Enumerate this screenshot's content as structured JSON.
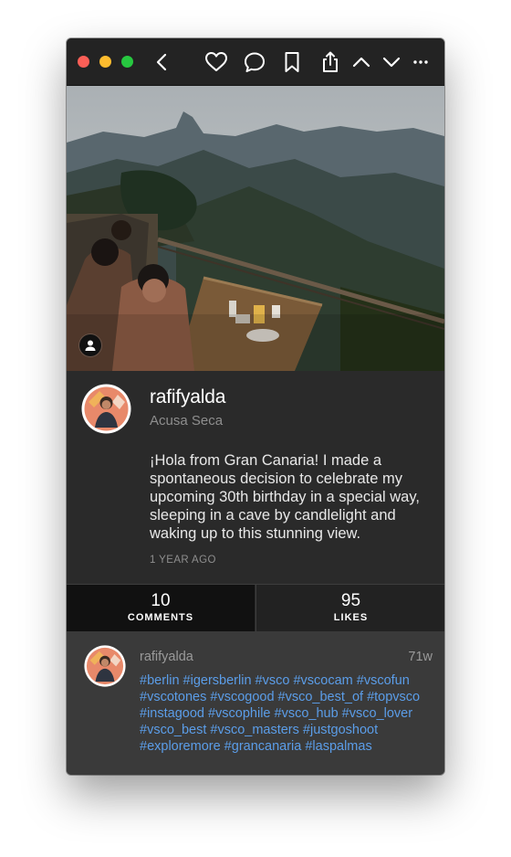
{
  "toolbar": {
    "icons": [
      "close-dot",
      "minimize-dot",
      "zoom-dot",
      "back-icon",
      "heart-icon",
      "comment-icon",
      "bookmark-icon",
      "share-icon",
      "up-icon",
      "down-icon",
      "more-icon"
    ],
    "colors": {
      "close": "#fc5f57",
      "minimize": "#fdbc2e",
      "zoom": "#27c840"
    }
  },
  "post": {
    "username": "rafifyalda",
    "location": "Acusa Seca",
    "caption": "¡Hola from Gran Canaria! I made a spontaneous decision to celebrate my upcoming 30th birthday in a special way, sleeping in a cave by candlelight and waking up to this stunning view.",
    "timestamp": "1 YEAR AGO"
  },
  "stats": {
    "comments": {
      "count": "10",
      "label": "COMMENTS"
    },
    "likes": {
      "count": "95",
      "label": "LIKES"
    }
  },
  "comment": {
    "username": "rafifyalda",
    "time": "71w",
    "text": "#berlin #igersberlin #vsco #vscocam #vscofun #vscotones #vscogood #vsco_best_of #topvsco #instagood #vscophile #vsco_hub #vsco_lover #vsco_best #vsco_masters #justgoshoot #exploremore #grancanaria #laspalmas"
  },
  "colors": {
    "background": "#2a2a2a",
    "hashtag": "#5b9de8",
    "muted": "#8e8e8e"
  }
}
